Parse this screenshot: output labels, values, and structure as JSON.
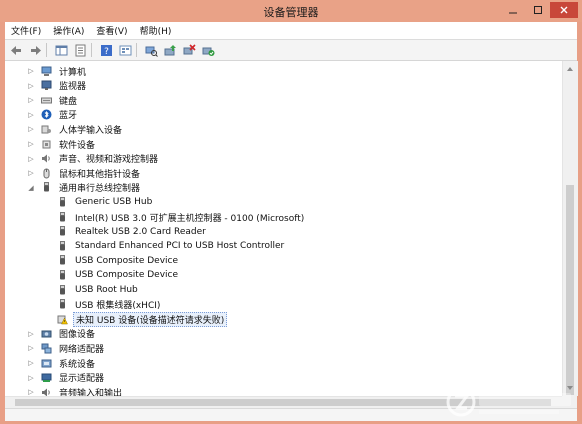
{
  "window": {
    "title": "设备管理器",
    "controls": {
      "minimize": "minimize-icon",
      "maximize": "maximize-icon",
      "close": "close-icon"
    }
  },
  "menu": [
    "文件(F)",
    "操作(A)",
    "查看(V)",
    "帮助(H)"
  ],
  "toolbar": {
    "icons": [
      "back-arrow-icon",
      "forward-arrow-icon",
      "console-tree-icon",
      "properties-icon",
      "help-icon",
      "view-icon",
      "scan-hardware-icon",
      "update-driver-icon",
      "uninstall-icon",
      "enable-device-icon"
    ]
  },
  "tree": [
    {
      "label": "计算机",
      "level": 0,
      "expander": "collapsed",
      "icon": "computer-icon"
    },
    {
      "label": "监视器",
      "level": 0,
      "expander": "collapsed",
      "icon": "monitor-icon"
    },
    {
      "label": "键盘",
      "level": 0,
      "expander": "collapsed",
      "icon": "keyboard-icon"
    },
    {
      "label": "蓝牙",
      "level": 0,
      "expander": "collapsed",
      "icon": "bluetooth-icon"
    },
    {
      "label": "人体学输入设备",
      "level": 0,
      "expander": "collapsed",
      "icon": "hid-icon"
    },
    {
      "label": "软件设备",
      "level": 0,
      "expander": "collapsed",
      "icon": "software-device-icon"
    },
    {
      "label": "声音、视频和游戏控制器",
      "level": 0,
      "expander": "collapsed",
      "icon": "speaker-icon"
    },
    {
      "label": "鼠标和其他指针设备",
      "level": 0,
      "expander": "collapsed",
      "icon": "mouse-icon"
    },
    {
      "label": "通用串行总线控制器",
      "level": 0,
      "expander": "expanded",
      "icon": "usb-plug-icon"
    },
    {
      "label": "Generic USB Hub",
      "level": 1,
      "expander": "",
      "icon": "usb-plug-icon"
    },
    {
      "label": "Intel(R) USB 3.0 可扩展主机控制器 - 0100 (Microsoft)",
      "level": 1,
      "expander": "",
      "icon": "usb-plug-icon"
    },
    {
      "label": "Realtek USB 2.0 Card Reader",
      "level": 1,
      "expander": "",
      "icon": "usb-plug-icon"
    },
    {
      "label": "Standard Enhanced PCI to USB Host Controller",
      "level": 1,
      "expander": "",
      "icon": "usb-plug-icon"
    },
    {
      "label": "USB Composite Device",
      "level": 1,
      "expander": "",
      "icon": "usb-plug-icon"
    },
    {
      "label": "USB Composite Device",
      "level": 1,
      "expander": "",
      "icon": "usb-plug-icon"
    },
    {
      "label": "USB Root Hub",
      "level": 1,
      "expander": "",
      "icon": "usb-plug-icon"
    },
    {
      "label": "USB 根集线器(xHCI)",
      "level": 1,
      "expander": "",
      "icon": "usb-plug-icon"
    },
    {
      "label": "未知 USB 设备(设备描述符请求失败)",
      "level": 1,
      "expander": "",
      "icon": "warning-device-icon",
      "selected": true
    },
    {
      "label": "图像设备",
      "level": 0,
      "expander": "collapsed",
      "icon": "camera-icon"
    },
    {
      "label": "网络适配器",
      "level": 0,
      "expander": "collapsed",
      "icon": "network-adapter-icon"
    },
    {
      "label": "系统设备",
      "level": 0,
      "expander": "collapsed",
      "icon": "system-device-icon"
    },
    {
      "label": "显示适配器",
      "level": 0,
      "expander": "collapsed",
      "icon": "display-adapter-icon"
    },
    {
      "label": "音频输入和输出",
      "level": 0,
      "expander": "collapsed",
      "icon": "audio-io-icon"
    }
  ],
  "watermark": {
    "icon": "watermark-logo-icon"
  }
}
